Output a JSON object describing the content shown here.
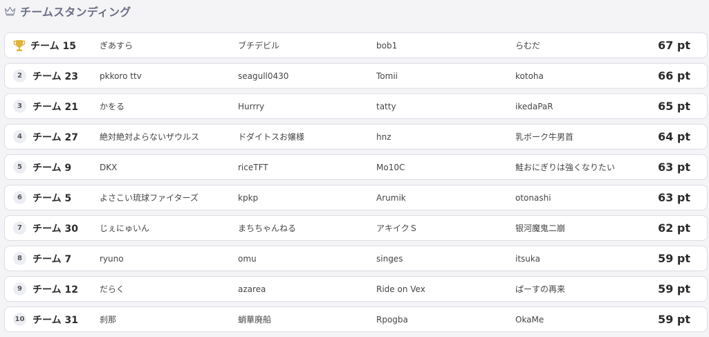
{
  "header": {
    "title": "チームスタンディング",
    "icon": "crown-icon"
  },
  "colors": {
    "title": "#6b6f84",
    "trophy": "#e2b43c",
    "row_border": "#dcdde3",
    "rank_badge": "#eceef3"
  },
  "standings": [
    {
      "rank": "1",
      "team": "チーム 15",
      "members": [
        "ぎあすら",
        "ブチデビル",
        "bob1",
        "らむだ"
      ],
      "points": "67 pt"
    },
    {
      "rank": "2",
      "team": "チーム 23",
      "members": [
        "pkkoro ttv",
        "seagull0430",
        "Tomii",
        "kotoha"
      ],
      "points": "66 pt"
    },
    {
      "rank": "3",
      "team": "チーム 21",
      "members": [
        "かをる",
        "Hurrry",
        "tatty",
        "ikedaPaR"
      ],
      "points": "65 pt"
    },
    {
      "rank": "4",
      "team": "チーム 27",
      "members": [
        "絶対絶対よらないザウルス",
        "ドダイトスお嬢様",
        "hnz",
        "乳ボーク牛男首"
      ],
      "points": "64 pt"
    },
    {
      "rank": "5",
      "team": "チーム 9",
      "members": [
        "DKX",
        "riceTFT",
        "Mo10C",
        "鮭おにぎりは強くなりたい"
      ],
      "points": "63 pt"
    },
    {
      "rank": "6",
      "team": "チーム 5",
      "members": [
        "よさこい琉球ファイターズ",
        "kpkp",
        "Arumik",
        "otonashi"
      ],
      "points": "63 pt"
    },
    {
      "rank": "7",
      "team": "チーム 30",
      "members": [
        "じぇにゅいん",
        "まちちゃんねる",
        "アキイクＳ",
        "银河魔鬼二崩"
      ],
      "points": "62 pt"
    },
    {
      "rank": "8",
      "team": "チーム 7",
      "members": [
        "ryuno",
        "omu",
        "singes",
        "itsuka"
      ],
      "points": "59 pt"
    },
    {
      "rank": "9",
      "team": "チーム 12",
      "members": [
        "だらく",
        "azarea",
        "Ride on Vex",
        "ぱーすの再来"
      ],
      "points": "59 pt"
    },
    {
      "rank": "10",
      "team": "チーム 31",
      "members": [
        "刹那",
        "蛸華廃船",
        "Rpogba",
        "OkaMe"
      ],
      "points": "59 pt"
    }
  ]
}
